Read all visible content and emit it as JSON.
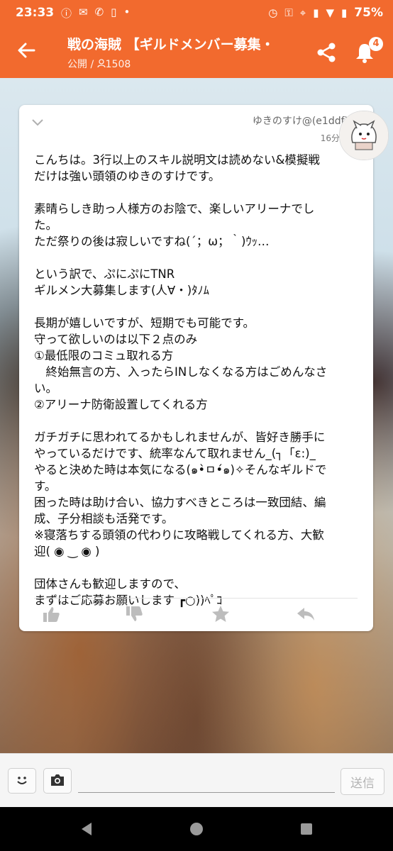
{
  "status_bar": {
    "time": "23:33",
    "battery": "75%"
  },
  "header": {
    "title": "戦の海賊 【ギルドメンバー募集・",
    "visibility": "公開",
    "separator": "/",
    "member_count": "1508",
    "notification_count": "4"
  },
  "post": {
    "author": "ゆきのすけ@(e1ddf)",
    "timestamp": "16分前",
    "body": "こんちは。3行以上のスキル説明文は読めない&模擬戦\nだけは強い頭領のゆきのすけです。\n\n素晴らしき助っ人様方のお陰で、楽しいアリーナでし\nた。\nただ祭りの後は寂しいですね(´；ω；｀)ｳｯ…\n\nという訳で、ぷにぷにTNR\nギルメン大募集します(人∀・)ﾀﾉﾑ\n\n長期が嬉しいですが、短期でも可能です。\n守って欲しいのは以下２点のみ\n①最低限のコミュ取れる方\n　終始無言の方、入ったらINしなくなる方はごめんなさ\nい。\n②アリーナ防衛設置してくれる方\n\nガチガチに思われてるかもしれませんが、皆好き勝手に\nやっているだけです、統率なんて取れません_(┐「ε:)_\nやると決めた時は本気になる(๑•̀ㅁ•́๑)✧そんなギルドで\nす。\n困った時は助け合い、協力すべきところは一致団結、編\n成、子分相談も活発です。\n※寝落ちする頭領の代わりに攻略戦してくれる方、大歓\n迎( ◉ ‿ ◉ )\n\n団体さんも歓迎しますので、\nまずはご応募お願いします ┏○))ﾍﾟｺ"
  },
  "input_bar": {
    "placeholder": "",
    "send_label": "送信"
  },
  "colors": {
    "brand": "#f26a2e",
    "icon_gray": "#bdbdbd"
  },
  "icons": [
    "back-arrow-icon",
    "share-icon",
    "bell-icon",
    "chevron-down-icon",
    "thumbs-up-icon",
    "thumbs-down-icon",
    "star-icon",
    "reply-icon",
    "smiley-icon",
    "camera-icon"
  ]
}
